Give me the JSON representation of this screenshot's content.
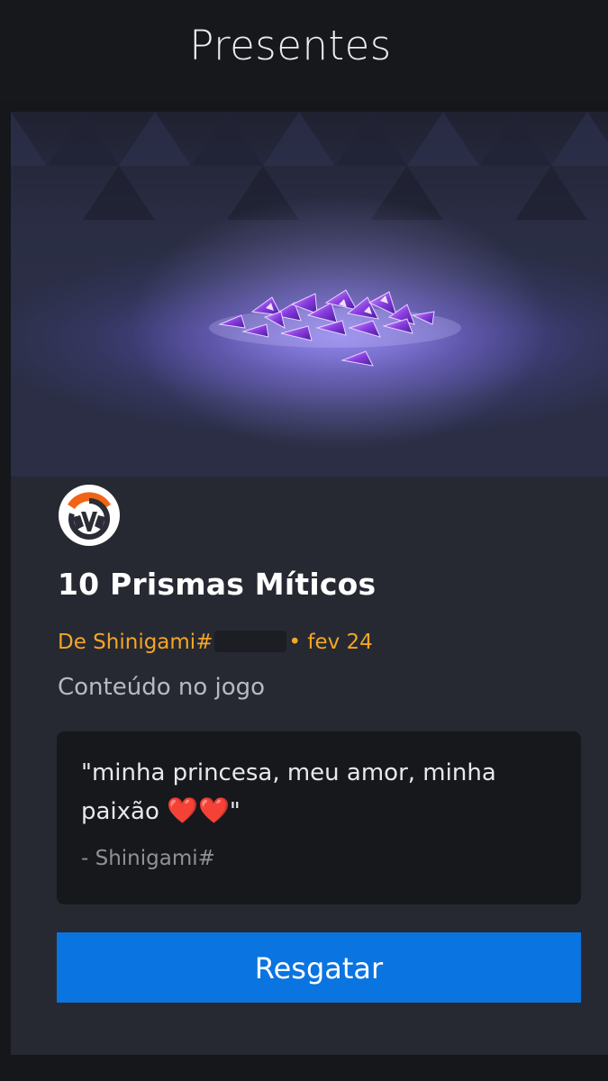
{
  "header": {
    "title": "Presentes"
  },
  "gift": {
    "hero_icon": "prism-pile-image",
    "game_icon": "overwatch-logo",
    "title": "10 Prismas Míticos",
    "from_prefix": "De Shinigami#",
    "date_suffix": "• fev 24",
    "content_type": "Conteúdo no jogo",
    "message_text": "\"minha princesa, meu amor, minha paixão ",
    "message_hearts": "❤️❤️",
    "message_close": "\"",
    "signature": "- Shinigami#"
  },
  "actions": {
    "redeem_label": "Resgatar"
  },
  "colors": {
    "accent_blue": "#0a74e0",
    "sender_orange": "#f5a623",
    "card_bg": "#262932",
    "page_bg": "#16171b"
  }
}
